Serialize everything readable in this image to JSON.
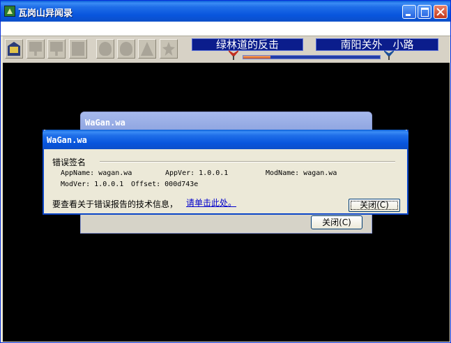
{
  "window": {
    "title": "瓦岗山异闻录"
  },
  "game": {
    "chapter_title": "绿林道的反击",
    "location": "南阳关外　小路",
    "progress_fraction": 0.2,
    "toolbar_icons": [
      "city-gate-icon",
      "character-icon",
      "party-icon",
      "status-icon",
      "item-icon",
      "system-icon",
      "map-icon",
      "settings-icon"
    ]
  },
  "back_dialog": {
    "title": "WaGan.wa",
    "close_label": "关闭(C)"
  },
  "error_dialog": {
    "title": "WaGan.wa",
    "signature_label": "错误签名",
    "app_name": "AppName: wagan.wa",
    "app_ver": "AppVer: 1.0.0.1",
    "mod_name": "ModName: wagan.wa",
    "mod_ver": "ModVer: 1.0.0.1",
    "offset": "Offset: 000d743e",
    "info_text": "要查看关于错误报告的技术信息，",
    "info_link": "请单击此处。",
    "close_label": "关闭(C)"
  }
}
